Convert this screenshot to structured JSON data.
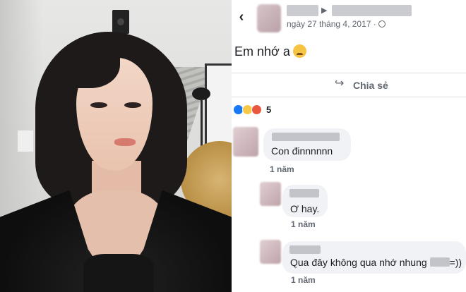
{
  "post": {
    "timestamp": "ngày 27 tháng 4, 2017 ·",
    "text": "Em nhớ a",
    "share_label": "Chia sẻ",
    "reaction_count": "5"
  },
  "comments": [
    {
      "text": "Con đinnnnnn",
      "time": "1 năm"
    },
    {
      "text": "Ơ hay.",
      "time": "1 năm"
    },
    {
      "text_before": "Qua đây không qua nhớ nhung",
      "text_after": "=))",
      "time": "1 năm"
    }
  ],
  "icons": {
    "back": "chevron-left-icon",
    "share": "share-arrow-icon",
    "globe": "globe-icon",
    "emoji": "crying-face-icon"
  },
  "colors": {
    "like": "#1877f2",
    "wow": "#f7c846",
    "angry": "#e9573f",
    "bubble": "#f0f2f5",
    "meta_text": "#606770"
  }
}
